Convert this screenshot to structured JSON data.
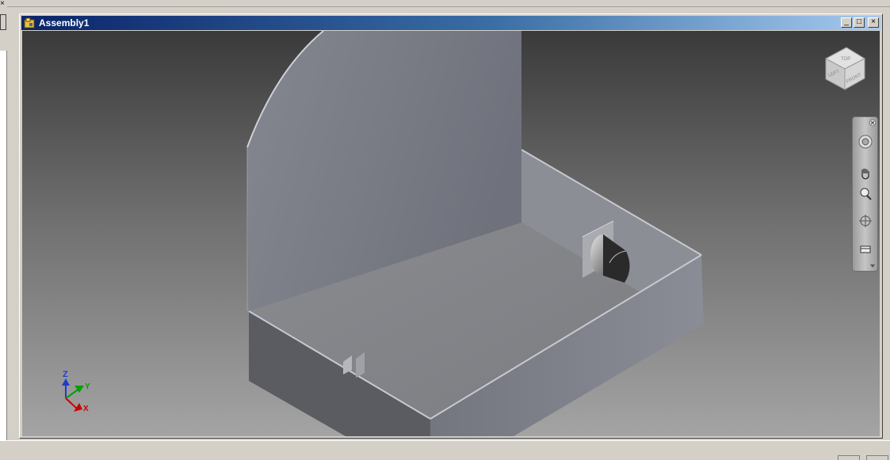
{
  "window": {
    "title": "Assembly1",
    "controls": {
      "minimize": "_",
      "restore": "□",
      "close": "×"
    }
  },
  "viewcube": {
    "faces": [
      "TOP",
      "LEFT",
      "FRONT"
    ],
    "icon": "viewcube-icon"
  },
  "navigation_bar": {
    "tools": [
      "steering-wheel-icon",
      "pan-hand-icon",
      "zoom-icon",
      "orbit-icon",
      "look-at-icon"
    ],
    "close_icon": "close-icon",
    "customize_icon": "chevron-down-icon"
  },
  "triad": {
    "z": "Z",
    "y": "Y",
    "x": "X"
  },
  "colors": {
    "titlebar_start": "#0a246a",
    "titlebar_end": "#a6caf0",
    "axis_x": "#cc0000",
    "axis_y": "#00a000",
    "axis_z": "#1a3ccc"
  }
}
